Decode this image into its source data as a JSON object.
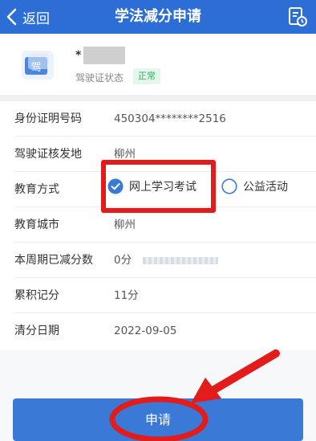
{
  "header": {
    "back_label": "返回",
    "title": "学法减分申请"
  },
  "profile": {
    "name_prefix": "*",
    "license_status_label": "驾驶证状态",
    "status_badge": "正常",
    "avatar_char": "驾"
  },
  "info": {
    "id_label": "身份证明号码",
    "id_value": "450304********2516",
    "license_place_label": "驾驶证核发地",
    "license_place_value": "柳州",
    "edu_method_label": "教育方式",
    "edu_option_online": "网上学习考试",
    "edu_option_public": "公益活动",
    "edu_city_label": "教育城市",
    "edu_city_value": "柳州",
    "deducted_label": "本周期已减分数",
    "deducted_value": "0分",
    "accumulated_label": "累积记分",
    "accumulated_value": "11分",
    "clear_date_label": "清分日期",
    "clear_date_value": "2022-09-05"
  },
  "footer": {
    "apply_label": "申请"
  },
  "colors": {
    "brand_blue": "#2d6ed6",
    "button_blue": "#3b79d6",
    "annotation_red": "#e21b1b",
    "status_green": "#2eb361"
  },
  "icons": {
    "back": "chevron-left-icon",
    "records": "document-clock-icon",
    "radio_checked": "radio-checked-icon",
    "radio_unchecked": "radio-unchecked-icon"
  }
}
